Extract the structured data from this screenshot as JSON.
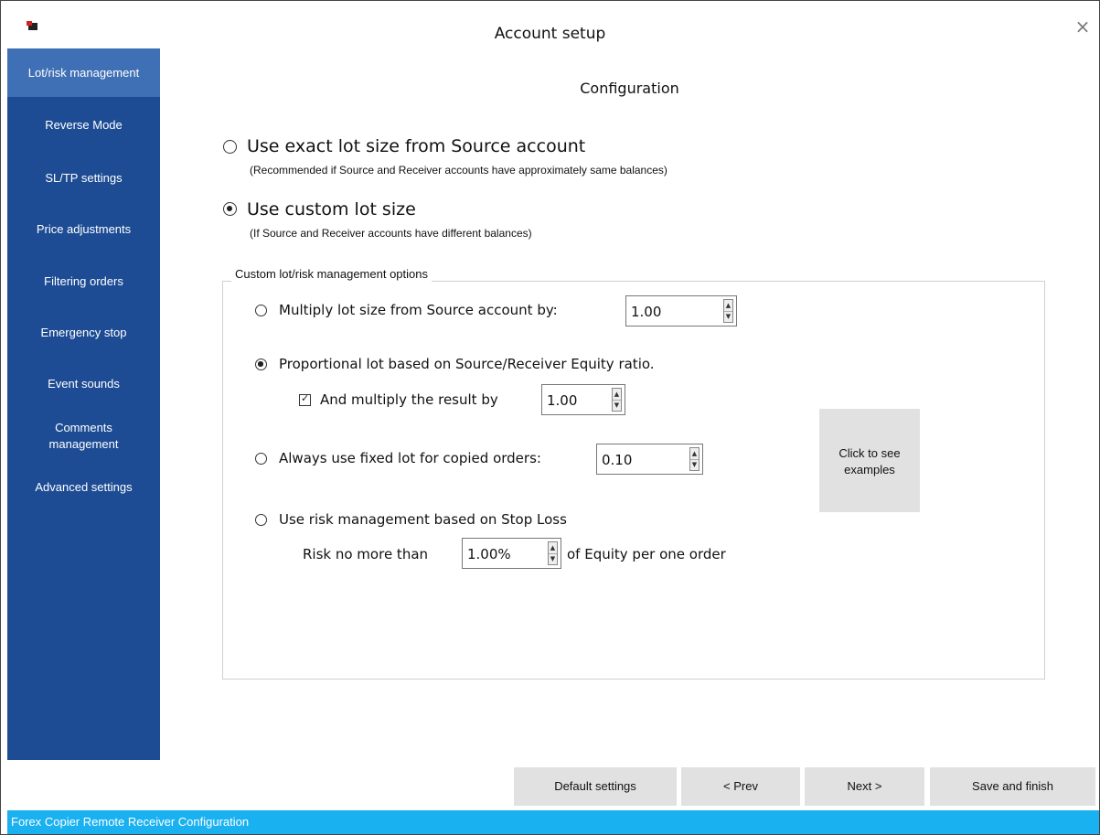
{
  "window": {
    "title": "Account setup",
    "close_glyph": "×"
  },
  "sidebar": {
    "items": [
      {
        "label": "Lot/risk management",
        "active": true
      },
      {
        "label": "Reverse Mode"
      },
      {
        "label": "SL/TP settings"
      },
      {
        "label": "Price adjustments"
      },
      {
        "label": "Filtering orders"
      },
      {
        "label": "Emergency stop"
      },
      {
        "label": "Event sounds"
      },
      {
        "label": "Comments\nmanagement"
      },
      {
        "label": "Advanced settings"
      }
    ]
  },
  "main": {
    "title": "Configuration",
    "mode_options": [
      {
        "label": "Use exact lot size from Source account",
        "note": "(Recommended if Source and Receiver accounts have approximately same balances)",
        "selected": false
      },
      {
        "label": "Use custom lot size",
        "note": "(If Source and Receiver accounts have different balances)",
        "selected": true
      }
    ],
    "custom_group": {
      "legend": "Custom lot/risk management options",
      "multiply": {
        "label": "Multiply lot size from Source account by:",
        "value": "1.00",
        "selected": false
      },
      "proportional": {
        "label": "Proportional lot based on Source/Receiver Equity ratio.",
        "selected": true,
        "checkbox_label": "And multiply the result by",
        "checkbox_checked": true,
        "value": "1.00"
      },
      "fixed": {
        "label": "Always use fixed lot for copied orders:",
        "value": "0.10",
        "selected": false
      },
      "risk": {
        "label": "Use risk management based on Stop Loss",
        "selected": false,
        "prefix": "Risk no more than",
        "value": "1.00%",
        "suffix": "of Equity per one order"
      },
      "examples_button": "Click to see\nexamples"
    }
  },
  "footer": {
    "buttons": {
      "default": "Default settings",
      "prev": "< Prev",
      "next": "Next >",
      "save": "Save and finish"
    }
  },
  "statusbar": {
    "text": "Forex Copier Remote Receiver Configuration"
  },
  "colors": {
    "sidebar": "#1d4c94",
    "sidebar_active": "#3f6fb5",
    "statusbar": "#1ab1f0",
    "button": "#e1e1e1"
  }
}
